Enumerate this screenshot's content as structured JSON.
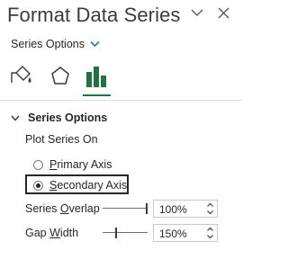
{
  "pane": {
    "title": "Format Data Series",
    "header_icons": [
      "dropdown-chevron-icon",
      "close-icon"
    ]
  },
  "options_dropdown": {
    "label": "Series Options"
  },
  "tabs": [
    {
      "name": "fill-line",
      "icon": "paint-bucket-icon",
      "selected": false
    },
    {
      "name": "effects",
      "icon": "pentagon-icon",
      "selected": false
    },
    {
      "name": "series-options",
      "icon": "bar-chart-icon",
      "selected": true
    }
  ],
  "section": {
    "title": "Series Options",
    "plot_on_label": "Plot Series On",
    "radios": [
      {
        "label": "Primary Axis",
        "checked": false
      },
      {
        "label": "Secondary Axis",
        "checked": true
      }
    ],
    "overlap": {
      "label": "Series Overlap",
      "value": "100%",
      "level": 1.0
    },
    "gap": {
      "label": "Gap Width",
      "value": "150%",
      "level": 0.3
    }
  },
  "colors": {
    "accent": "#217346",
    "text": "#262626"
  }
}
